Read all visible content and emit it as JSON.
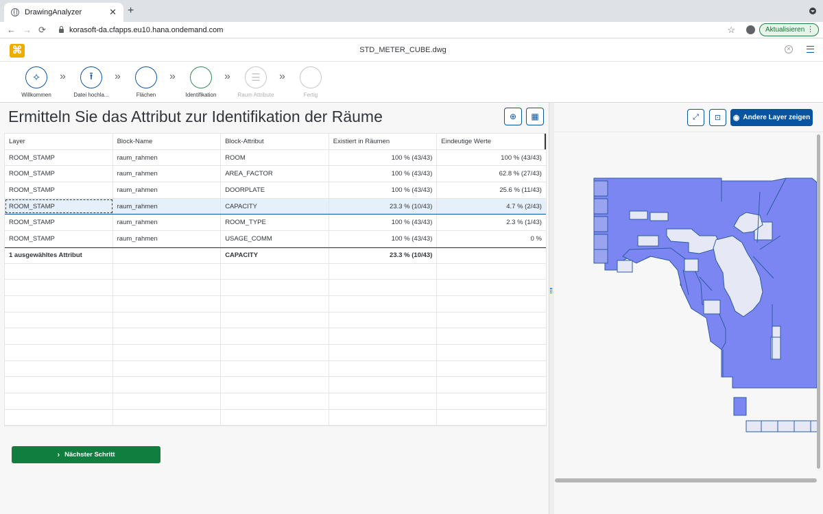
{
  "browser": {
    "tab_title": "DrawingAnalyzer",
    "new_tab": "+",
    "close_tab": "✕",
    "url": "korasoft-da.cfapps.eu10.hana.ondemand.com",
    "update_label": "Aktualisieren",
    "menu_dots": "⋮",
    "back": "←",
    "forward": "→",
    "reload": "⟳",
    "star": "☆"
  },
  "shell": {
    "logo": "⌘",
    "document_title": "STD_METER_CUBE.dwg",
    "close": "✕"
  },
  "wizard": {
    "steps": [
      {
        "label": "Willkommen",
        "icon": "magic-wand-icon",
        "glyph": "✧",
        "state": "done"
      },
      {
        "label": "Datei hochla...",
        "icon": "upload-icon",
        "glyph": "⭱",
        "state": "done"
      },
      {
        "label": "Flächen",
        "icon": "",
        "glyph": "",
        "state": "done"
      },
      {
        "label": "Identifikation",
        "icon": "",
        "glyph": "",
        "state": "current"
      },
      {
        "label": "Raum Attribute",
        "icon": "list-icon",
        "glyph": "☰",
        "state": "disabled"
      },
      {
        "label": "Fertig",
        "icon": "",
        "glyph": "",
        "state": "disabled"
      }
    ],
    "chevron": "»"
  },
  "main": {
    "title": "Ermitteln Sie das Attribut zur Identifikation der Räume",
    "zoom_glyph": "⊕",
    "grid_glyph": "▦",
    "next_label": "Nächster Schritt",
    "next_arrow": "›"
  },
  "table": {
    "columns": [
      "Layer",
      "Block-Name",
      "Block-Attribut",
      "Existiert in Räumen",
      "Eindeutige Werte"
    ],
    "rows": [
      [
        "ROOM_STAMP",
        "raum_rahmen",
        "ROOM",
        "100 % (43/43)",
        "100 % (43/43)"
      ],
      [
        "ROOM_STAMP",
        "raum_rahmen",
        "AREA_FACTOR",
        "100 % (43/43)",
        "62.8 % (27/43)"
      ],
      [
        "ROOM_STAMP",
        "raum_rahmen",
        "DOORPLATE",
        "100 % (43/43)",
        "25.6 % (11/43)"
      ],
      [
        "ROOM_STAMP",
        "raum_rahmen",
        "CAPACITY",
        "23.3 % (10/43)",
        "4.7 % (2/43)"
      ],
      [
        "ROOM_STAMP",
        "raum_rahmen",
        "ROOM_TYPE",
        "100 % (43/43)",
        "2.3 % (1/43)"
      ],
      [
        "ROOM_STAMP",
        "raum_rahmen",
        "USAGE_COMM",
        "100 % (43/43)",
        "0 %"
      ]
    ],
    "selected_row": 3,
    "summary": [
      "1 ausgewähltes Attribut",
      "",
      "CAPACITY",
      "23.3 % (10/43)",
      ""
    ]
  },
  "viewer": {
    "layer_button": "Andere Layer zeigen",
    "eye_glyph": "◉",
    "expand_glyph": "⤢",
    "fit_glyph": "⊡",
    "floor_color": "#7b86f2",
    "room_color": "#e6e9f5",
    "line_color": "#2c5aa0"
  }
}
